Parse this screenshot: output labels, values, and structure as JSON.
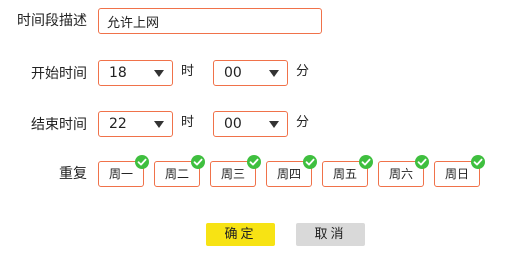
{
  "form": {
    "description_label": "时间段描述",
    "description_value": "允许上网",
    "start_time_label": "开始时间",
    "end_time_label": "结束时间",
    "repeat_label": "重复",
    "start_hour": "18",
    "start_minute": "00",
    "end_hour": "22",
    "end_minute": "00",
    "hour_unit": "时",
    "minute_unit": "分"
  },
  "days": [
    {
      "label": "周一",
      "checked": true
    },
    {
      "label": "周二",
      "checked": true
    },
    {
      "label": "周三",
      "checked": true
    },
    {
      "label": "周四",
      "checked": true
    },
    {
      "label": "周五",
      "checked": true
    },
    {
      "label": "周六",
      "checked": true
    },
    {
      "label": "周日",
      "checked": true
    }
  ],
  "buttons": {
    "confirm_label": "确定",
    "cancel_label": "取消"
  },
  "colors": {
    "border_accent": "#f0724a",
    "check_green": "#3fbf3f",
    "confirm_bg": "#f7e314",
    "cancel_bg": "#d9d9d9"
  },
  "icons": {
    "dropdown": "caret-down-icon",
    "day_selected": "check-circle-icon"
  }
}
